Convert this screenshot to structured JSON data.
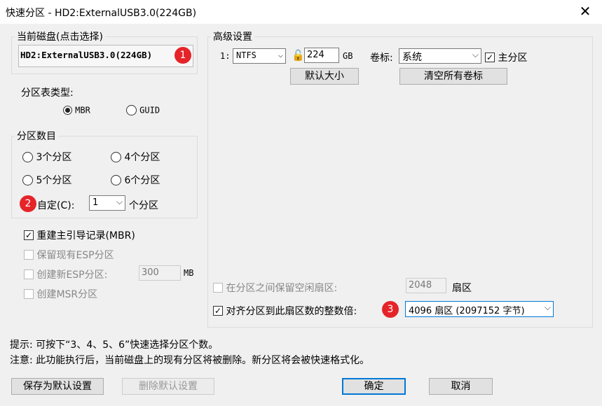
{
  "window": {
    "title": "快速分区 - HD2:ExternalUSB3.0(224GB)",
    "close_icon": "✕"
  },
  "current_disk": {
    "legend": "当前磁盘(点击选择)",
    "value": "HD2:ExternalUSB3.0(224GB)",
    "badge": "1"
  },
  "partition_table": {
    "label": "分区表类型:",
    "options": [
      "MBR",
      "GUID"
    ],
    "selected": "MBR"
  },
  "partition_count": {
    "legend": "分区数目",
    "options": [
      "3个分区",
      "4个分区",
      "5个分区",
      "6个分区"
    ],
    "custom_label": "自定(C):",
    "custom_value": "1",
    "custom_suffix": "个分区",
    "badge": "2"
  },
  "options": {
    "rebuild_mbr": {
      "label": "重建主引导记录(MBR)",
      "checked": true
    },
    "keep_esp": {
      "label": "保留现有ESP分区",
      "checked": false,
      "disabled": true
    },
    "create_esp": {
      "label": "创建新ESP分区:",
      "checked": false,
      "disabled": true,
      "value": "300",
      "unit": "MB"
    },
    "create_msr": {
      "label": "创建MSR分区",
      "checked": false,
      "disabled": true
    }
  },
  "advanced": {
    "legend": "高级设置",
    "row_index": "1:",
    "fs": "NTFS",
    "size": "224",
    "size_unit": "GB",
    "volume_label": "卷标:",
    "volume_value": "系统",
    "primary_label": "主分区",
    "primary_checked": true,
    "default_size_button": "默认大小",
    "clear_labels_button": "清空所有卷标",
    "reserve_label": "在分区之间保留空闲扇区:",
    "reserve_value": "2048",
    "reserve_unit": "扇区",
    "align_label": "对齐分区到此扇区数的整数倍:",
    "align_checked": true,
    "align_value": "4096 扇区 (2097152 字节)",
    "badge": "3"
  },
  "hints": {
    "line1": "提示: 可按下“3、4、5、6”快速选择分区个数。",
    "line2": "注意: 此功能执行后，当前磁盘上的现有分区将被删除。新分区将会被快速格式化。"
  },
  "buttons": {
    "save_default": "保存为默认设置",
    "delete_default": "删除默认设置",
    "ok": "确定",
    "cancel": "取消"
  }
}
